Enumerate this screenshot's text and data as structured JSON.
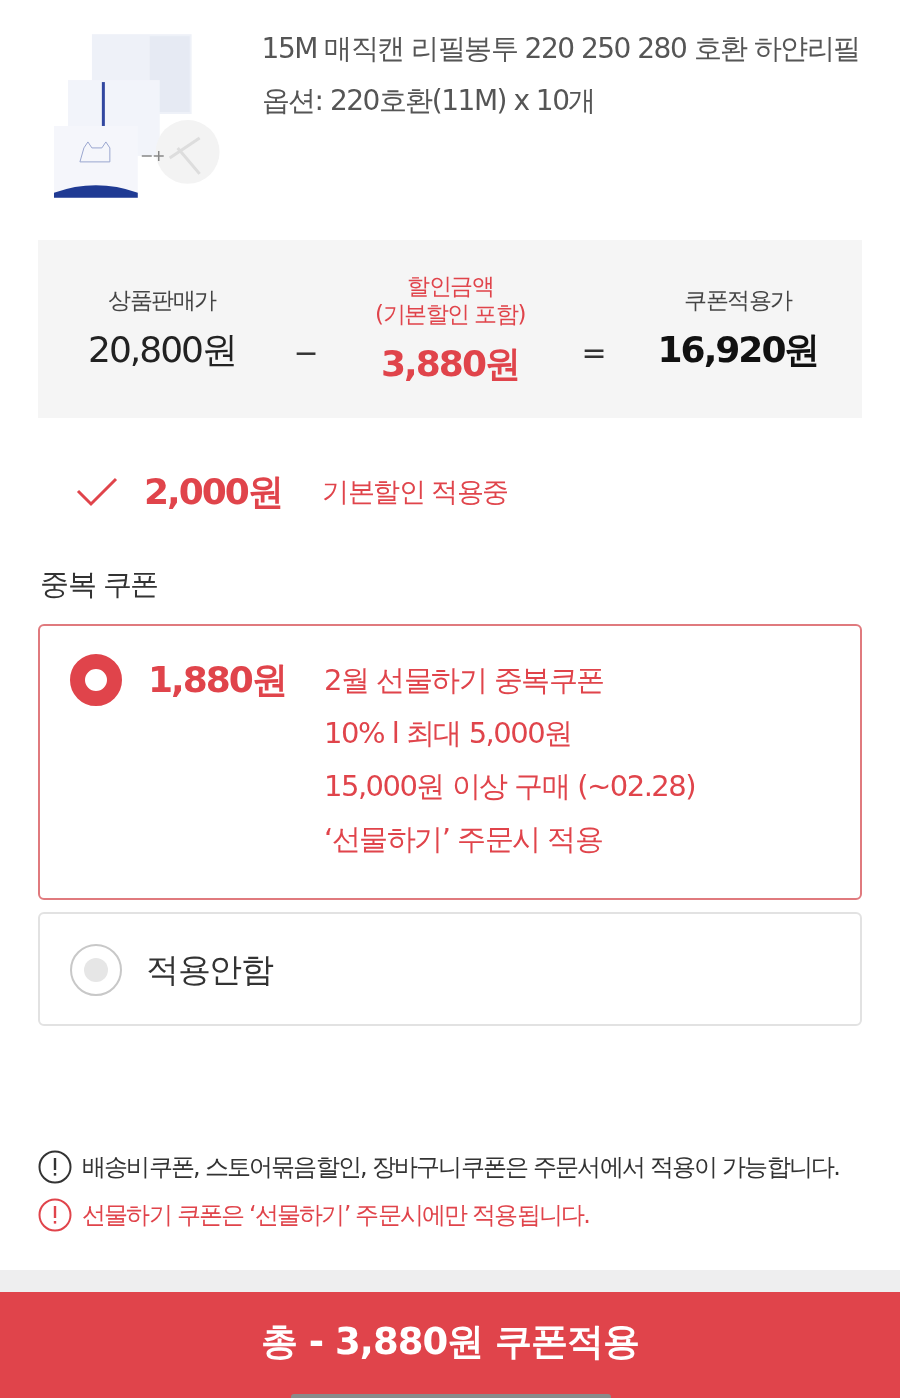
{
  "product": {
    "title": "15M 매직캔 리필봉투 220 250 280 호환 하얀리필",
    "option": "옵션: 220호환(11M) x 10개"
  },
  "summary": {
    "items": [
      {
        "kind": "price",
        "label": "상품판매가",
        "value": "20,800원"
      },
      {
        "kind": "discount",
        "label": "할인금액",
        "sublabel": "(기본할인 포함)",
        "value": "3,880원"
      },
      {
        "kind": "final",
        "label": "쿠폰적용가",
        "value": "16,920원"
      }
    ],
    "operators": [
      "−",
      "="
    ]
  },
  "basic_discount": {
    "checked": true,
    "amount": "2,000원",
    "label": "기본할인 적용중"
  },
  "coupon_section": {
    "title": "중복 쿠폰",
    "options": [
      {
        "selected": true,
        "amount": "1,880원",
        "lines": [
          "2월 선물하기 중복쿠폰",
          "10% l 최대 5,000원",
          "15,000원 이상 구매 (~02.28)",
          "‘선물하기’ 주문시 적용"
        ]
      },
      {
        "selected": false,
        "label": "적용안함"
      }
    ]
  },
  "notices": [
    {
      "kind": "info",
      "text": "배송비쿠폰, 스토어묶음할인, 장바구니쿠폰은 주문서에서 적용이 가능합니다."
    },
    {
      "kind": "warning",
      "text": "선물하기 쿠폰은 ‘선물하기’ 주문시에만 적용됩니다."
    }
  ],
  "apply_button": {
    "label": "총 - 3,880원 쿠폰적용"
  }
}
